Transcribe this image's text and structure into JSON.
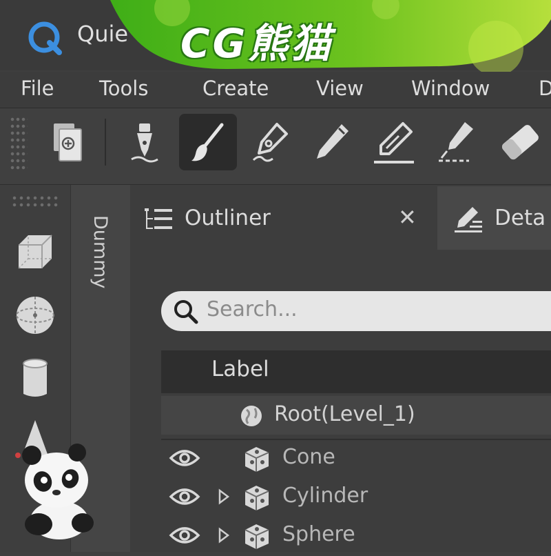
{
  "app": {
    "title": "Quie"
  },
  "watermark": {
    "text": "CG熊猫"
  },
  "menu": [
    "File",
    "Tools",
    "Create",
    "View",
    "Window",
    "D"
  ],
  "toolbar": {
    "tools": [
      {
        "icon": "new-document-icon",
        "active": false
      },
      {
        "icon": "fountain-pen-nib-icon",
        "active": false
      },
      {
        "icon": "paintbrush-icon",
        "active": true
      },
      {
        "icon": "pen-nib-icon",
        "active": false
      },
      {
        "icon": "pencil-icon",
        "active": false
      },
      {
        "icon": "marker-icon",
        "active": false
      },
      {
        "icon": "calligraphy-pen-icon",
        "active": false
      },
      {
        "icon": "eraser-icon",
        "active": false
      }
    ]
  },
  "left_dock": {
    "icons": [
      "cube-icon",
      "sphere-icon",
      "cylinder-icon",
      "cone-icon"
    ]
  },
  "dummy_tab": {
    "label": "Dummy"
  },
  "tabs": [
    {
      "label": "Outliner",
      "icon": "list-tree-icon",
      "active": true
    },
    {
      "label": "Deta",
      "icon": "details-edit-icon",
      "active": false
    }
  ],
  "search": {
    "placeholder": "Search..."
  },
  "table": {
    "header": "Label",
    "rows": [
      {
        "label": "Root(Level_1)",
        "icon": "globe-icon",
        "visible": false,
        "expandable": false
      },
      {
        "label": "Cone",
        "icon": "mesh-cube-icon",
        "visible": true,
        "expandable": false
      },
      {
        "label": "Cylinder",
        "icon": "mesh-cube-icon",
        "visible": true,
        "expandable": true
      },
      {
        "label": "Sphere",
        "icon": "mesh-cube-icon",
        "visible": true,
        "expandable": true
      }
    ]
  },
  "colors": {
    "banner_green": "#6cc21e",
    "banner_light": "#c6e84a",
    "logo_blue": "#3c8fe0",
    "active_tool_bg": "#2b2b2b"
  }
}
